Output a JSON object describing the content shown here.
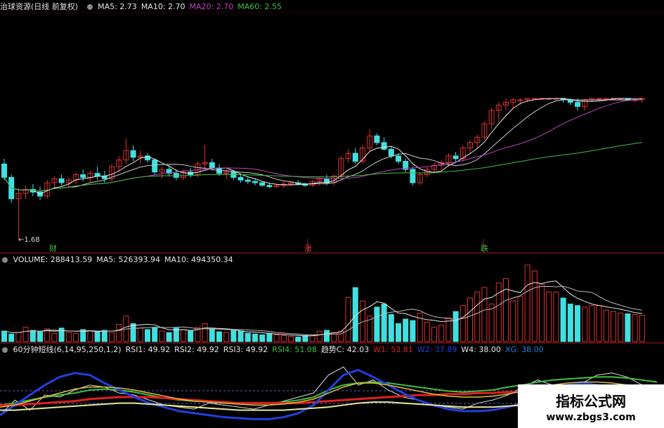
{
  "header": {
    "title": "治球资源(日线 前复权)",
    "ma": [
      {
        "label": "MA5: 2.73",
        "color": "#e8e8e8"
      },
      {
        "label": "MA10: 2.70",
        "color": "#e8e8e8"
      },
      {
        "label": "MA20: 2.70",
        "color": "#c040c0"
      },
      {
        "label": "MA60: 2.55",
        "color": "#40c040"
      }
    ]
  },
  "volume_header": [
    {
      "label": "VOLUME: 288413.59",
      "color": "#e8e8e8"
    },
    {
      "label": "MA5: 526393.94",
      "color": "#e8e8e8"
    },
    {
      "label": "MA10: 494350.34",
      "color": "#e8e8e8"
    }
  ],
  "indicator_header": [
    {
      "label": "60分钟短线(6,14,95,250,1,2)",
      "color": "#e8e8e8"
    },
    {
      "label": "RSI1: 49.92",
      "color": "#e8e8e8"
    },
    {
      "label": "RSI2: 49.92",
      "color": "#e8e8e8"
    },
    {
      "label": "RSI3: 49.92",
      "color": "#e8e8e8"
    },
    {
      "label": "RSI4: 51.08",
      "color": "#40c040"
    },
    {
      "label": "趋势C: 42.03",
      "color": "#e8e8e8"
    },
    {
      "label": "W1: 53.81",
      "color": "#e02020"
    },
    {
      "label": "W2: 37.89",
      "color": "#2040e0"
    },
    {
      "label": "W4: 38.00",
      "color": "#e8e8e8"
    },
    {
      "label": "XG: 38.00",
      "color": "#2080e0"
    }
  ],
  "low_label": "1.68",
  "markers": [
    {
      "label": "财",
      "color": "#40c040"
    },
    {
      "label": "涨",
      "color": "#e04040"
    },
    {
      "label": "跌",
      "color": "#40c040"
    }
  ],
  "watermark": {
    "line1": "指标公式网",
    "line2": "www.zbgs3.com"
  },
  "colors": {
    "up": "#e03030",
    "down": "#40e0e0",
    "ma5": "#e8e8e8",
    "ma20": "#c040c0",
    "ma60": "#40c040",
    "sep": "#a02020"
  },
  "chart_data": [
    {
      "type": "candlestick",
      "title": "治球资源(日线 前复权)",
      "low_marker": 1.68,
      "ohlc": [
        [
          2.24,
          2.28,
          2.12,
          2.14
        ],
        [
          2.14,
          2.16,
          1.95,
          1.98
        ],
        [
          1.98,
          2.06,
          1.68,
          2.02
        ],
        [
          2.02,
          2.08,
          1.98,
          2.05
        ],
        [
          2.05,
          2.09,
          2.0,
          2.03
        ],
        [
          2.03,
          2.07,
          1.97,
          2.0
        ],
        [
          2.0,
          2.12,
          1.98,
          2.1
        ],
        [
          2.1,
          2.15,
          2.06,
          2.13
        ],
        [
          2.13,
          2.16,
          2.08,
          2.1
        ],
        [
          2.1,
          2.14,
          2.06,
          2.12
        ],
        [
          2.12,
          2.18,
          2.09,
          2.16
        ],
        [
          2.16,
          2.2,
          2.11,
          2.14
        ],
        [
          2.14,
          2.19,
          2.1,
          2.17
        ],
        [
          2.17,
          2.22,
          2.12,
          2.15
        ],
        [
          2.15,
          2.19,
          2.1,
          2.13
        ],
        [
          2.13,
          2.24,
          2.11,
          2.22
        ],
        [
          2.22,
          2.3,
          2.18,
          2.27
        ],
        [
          2.27,
          2.43,
          2.24,
          2.34
        ],
        [
          2.34,
          2.38,
          2.26,
          2.29
        ],
        [
          2.29,
          2.34,
          2.24,
          2.3
        ],
        [
          2.3,
          2.32,
          2.25,
          2.27
        ],
        [
          2.27,
          2.28,
          2.16,
          2.18
        ],
        [
          2.18,
          2.22,
          2.13,
          2.2
        ],
        [
          2.2,
          2.23,
          2.15,
          2.17
        ],
        [
          2.17,
          2.2,
          2.12,
          2.14
        ],
        [
          2.14,
          2.2,
          2.12,
          2.18
        ],
        [
          2.18,
          2.21,
          2.14,
          2.16
        ],
        [
          2.16,
          2.26,
          2.14,
          2.24
        ],
        [
          2.24,
          2.38,
          2.2,
          2.25
        ],
        [
          2.25,
          2.28,
          2.19,
          2.21
        ],
        [
          2.21,
          2.24,
          2.15,
          2.17
        ],
        [
          2.17,
          2.2,
          2.13,
          2.18
        ],
        [
          2.18,
          2.19,
          2.12,
          2.14
        ],
        [
          2.14,
          2.16,
          2.1,
          2.12
        ],
        [
          2.12,
          2.14,
          2.09,
          2.11
        ],
        [
          2.11,
          2.13,
          2.08,
          2.1
        ],
        [
          2.1,
          2.11,
          2.07,
          2.08
        ],
        [
          2.08,
          2.1,
          2.06,
          2.07
        ],
        [
          2.07,
          2.09,
          2.06,
          2.08
        ],
        [
          2.08,
          2.11,
          2.06,
          2.09
        ],
        [
          2.09,
          2.11,
          2.07,
          2.1
        ],
        [
          2.1,
          2.12,
          2.08,
          2.09
        ],
        [
          2.09,
          2.1,
          2.07,
          2.08
        ],
        [
          2.08,
          2.12,
          2.07,
          2.11
        ],
        [
          2.11,
          2.14,
          2.08,
          2.13
        ],
        [
          2.13,
          2.16,
          2.08,
          2.1
        ],
        [
          2.1,
          2.16,
          2.08,
          2.15
        ],
        [
          2.15,
          2.3,
          2.13,
          2.28
        ],
        [
          2.28,
          2.35,
          2.25,
          2.32
        ],
        [
          2.32,
          2.36,
          2.24,
          2.26
        ],
        [
          2.26,
          2.38,
          2.24,
          2.36
        ],
        [
          2.36,
          2.5,
          2.33,
          2.45
        ],
        [
          2.45,
          2.47,
          2.38,
          2.4
        ],
        [
          2.4,
          2.44,
          2.34,
          2.35
        ],
        [
          2.35,
          2.37,
          2.28,
          2.3
        ],
        [
          2.3,
          2.32,
          2.24,
          2.26
        ],
        [
          2.26,
          2.28,
          2.18,
          2.2
        ],
        [
          2.2,
          2.22,
          2.08,
          2.1
        ],
        [
          2.1,
          2.18,
          2.08,
          2.16
        ],
        [
          2.16,
          2.22,
          2.14,
          2.2
        ],
        [
          2.2,
          2.25,
          2.17,
          2.23
        ],
        [
          2.23,
          2.27,
          2.2,
          2.25
        ],
        [
          2.25,
          2.32,
          2.22,
          2.3
        ],
        [
          2.3,
          2.33,
          2.25,
          2.28
        ],
        [
          2.28,
          2.38,
          2.26,
          2.36
        ],
        [
          2.36,
          2.42,
          2.32,
          2.4
        ],
        [
          2.4,
          2.46,
          2.36,
          2.44
        ],
        [
          2.44,
          2.56,
          2.42,
          2.54
        ],
        [
          2.54,
          2.66,
          2.5,
          2.64
        ],
        [
          2.64,
          2.7,
          2.56,
          2.68
        ],
        [
          2.68,
          2.73,
          2.64,
          2.7
        ],
        [
          2.7,
          2.73,
          2.66,
          2.72
        ],
        [
          2.72,
          2.73,
          2.68,
          2.72
        ],
        [
          2.72,
          2.73,
          2.7,
          2.73
        ],
        [
          2.73,
          2.73,
          2.72,
          2.73
        ],
        [
          2.73,
          2.73,
          2.72,
          2.73
        ],
        [
          2.73,
          2.73,
          2.72,
          2.73
        ],
        [
          2.73,
          2.73,
          2.71,
          2.73
        ],
        [
          2.73,
          2.73,
          2.7,
          2.72
        ],
        [
          2.72,
          2.73,
          2.68,
          2.7
        ],
        [
          2.7,
          2.73,
          2.64,
          2.67
        ],
        [
          2.67,
          2.73,
          2.64,
          2.72
        ],
        [
          2.72,
          2.73,
          2.7,
          2.73
        ],
        [
          2.73,
          2.73,
          2.71,
          2.73
        ],
        [
          2.73,
          2.73,
          2.72,
          2.73
        ],
        [
          2.73,
          2.73,
          2.72,
          2.73
        ],
        [
          2.73,
          2.73,
          2.72,
          2.73
        ],
        [
          2.73,
          2.73,
          2.71,
          2.72
        ],
        [
          2.72,
          2.73,
          2.7,
          2.72
        ],
        [
          2.72,
          2.73,
          2.7,
          2.73
        ]
      ],
      "ma": {
        "MA5": 2.73,
        "MA10": 2.7,
        "MA20": 2.7,
        "MA60": 2.55
      }
    },
    {
      "type": "bar",
      "title": "VOLUME",
      "values": [
        70,
        50,
        60,
        95,
        75,
        65,
        85,
        55,
        90,
        60,
        55,
        80,
        70,
        65,
        75,
        60,
        115,
        170,
        120,
        90,
        80,
        95,
        70,
        60,
        90,
        80,
        70,
        95,
        120,
        85,
        65,
        60,
        75,
        70,
        55,
        50,
        45,
        55,
        45,
        40,
        35,
        30,
        40,
        45,
        70,
        75,
        60,
        70,
        295,
        360,
        270,
        170,
        230,
        250,
        180,
        120,
        150,
        140,
        190,
        130,
        95,
        110,
        160,
        200,
        240,
        290,
        330,
        360,
        250,
        390,
        420,
        270,
        300,
        510,
        470,
        380,
        330,
        330,
        290,
        250,
        240,
        230,
        240,
        240,
        210,
        200,
        190,
        185,
        180,
        175
      ],
      "latest": 288413.59,
      "ma5": 526393.94,
      "ma10": 494350.34
    },
    {
      "type": "line",
      "title": "60分钟短线(6,14,95,250,1,2)",
      "series": [
        {
          "name": "RSI1",
          "values": [
            30,
            45,
            35,
            50,
            48,
            55,
            60,
            58,
            52,
            50,
            45,
            40,
            38,
            36,
            42,
            40,
            38,
            36,
            40,
            44,
            48,
            52,
            70,
            78,
            60,
            65,
            55,
            48,
            45,
            40,
            38,
            36,
            42,
            45,
            50,
            58,
            65,
            60,
            55,
            62,
            70,
            72,
            68,
            60,
            52
          ]
        },
        {
          "name": "RSI4",
          "values": [
            40,
            42,
            45,
            48,
            50,
            52,
            55,
            56,
            55,
            53,
            50,
            47,
            45,
            44,
            44,
            43,
            42,
            42,
            42,
            43,
            45,
            48,
            55,
            60,
            62,
            63,
            62,
            60,
            58,
            56,
            54,
            53,
            54,
            55,
            58,
            60,
            63,
            65,
            66,
            67,
            68,
            68,
            67,
            65,
            63
          ]
        },
        {
          "name": "W1",
          "values": [
            40,
            40,
            41,
            42,
            43,
            44,
            46,
            47,
            48,
            48,
            48,
            47,
            46,
            45,
            44,
            43,
            42,
            42,
            42,
            42,
            42,
            43,
            44,
            45,
            46,
            47,
            48,
            49,
            50,
            50,
            51,
            51,
            52,
            52,
            53,
            53,
            54,
            54,
            55,
            55,
            55,
            55,
            54,
            54,
            54
          ]
        },
        {
          "name": "W2",
          "values": [
            30,
            40,
            50,
            60,
            68,
            72,
            70,
            62,
            55,
            48,
            42,
            38,
            34,
            32,
            30,
            28,
            27,
            26,
            26,
            28,
            32,
            40,
            55,
            70,
            75,
            68,
            60,
            52,
            45,
            40,
            36,
            34,
            34,
            35,
            38,
            42,
            48,
            56,
            60,
            62,
            60,
            55,
            48,
            42,
            38
          ]
        },
        {
          "name": "W4",
          "values": [
            35,
            35,
            36,
            37,
            38,
            39,
            40,
            41,
            42,
            42,
            41,
            40,
            39,
            38,
            37,
            36,
            35,
            35,
            35,
            35,
            36,
            37,
            38,
            40,
            42,
            43,
            43,
            42,
            41,
            40,
            39,
            38,
            38,
            38,
            39,
            40,
            41,
            42,
            43,
            44,
            44,
            43,
            42,
            41,
            40
          ]
        },
        {
          "name": "RSI2",
          "values": [
            38,
            40,
            44,
            48,
            52,
            56,
            58,
            58,
            57,
            55,
            52,
            49,
            46,
            44,
            43,
            42,
            41,
            40,
            40,
            41,
            43,
            46,
            52,
            58,
            62,
            62,
            60,
            57,
            54,
            51,
            49,
            48,
            48,
            49,
            51,
            54,
            57,
            60,
            62,
            63,
            63,
            62,
            60,
            57,
            54
          ]
        }
      ]
    }
  ]
}
